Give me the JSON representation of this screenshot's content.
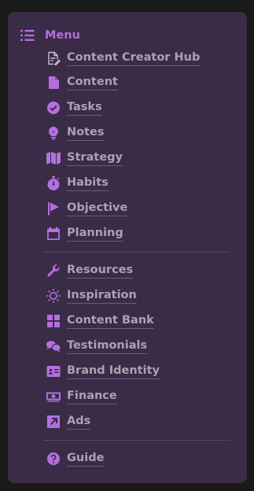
{
  "menu": {
    "title": "Menu",
    "icon": "list-icon",
    "accent_color": "#b36fe0"
  },
  "groups": [
    {
      "items": [
        {
          "label": "Content Creator Hub",
          "icon": "page-edit-icon"
        },
        {
          "label": "Content",
          "icon": "document-icon"
        },
        {
          "label": "Tasks",
          "icon": "check-circle-icon"
        },
        {
          "label": "Notes",
          "icon": "lightbulb-icon"
        },
        {
          "label": "Strategy",
          "icon": "map-icon"
        },
        {
          "label": "Habits",
          "icon": "stopwatch-icon"
        },
        {
          "label": "Objective",
          "icon": "flag-icon"
        },
        {
          "label": "Planning",
          "icon": "calendar-icon"
        }
      ]
    },
    {
      "items": [
        {
          "label": "Resources",
          "icon": "wrench-icon"
        },
        {
          "label": "Inspiration",
          "icon": "sun-icon"
        },
        {
          "label": "Content Bank",
          "icon": "grid-icon"
        },
        {
          "label": "Testimonials",
          "icon": "chat-bubbles-icon"
        },
        {
          "label": "Brand Identity",
          "icon": "id-card-icon"
        },
        {
          "label": "Finance",
          "icon": "money-icon"
        },
        {
          "label": "Ads",
          "icon": "arrow-box-icon"
        }
      ]
    },
    {
      "items": [
        {
          "label": "Guide",
          "icon": "question-circle-icon"
        }
      ]
    }
  ]
}
